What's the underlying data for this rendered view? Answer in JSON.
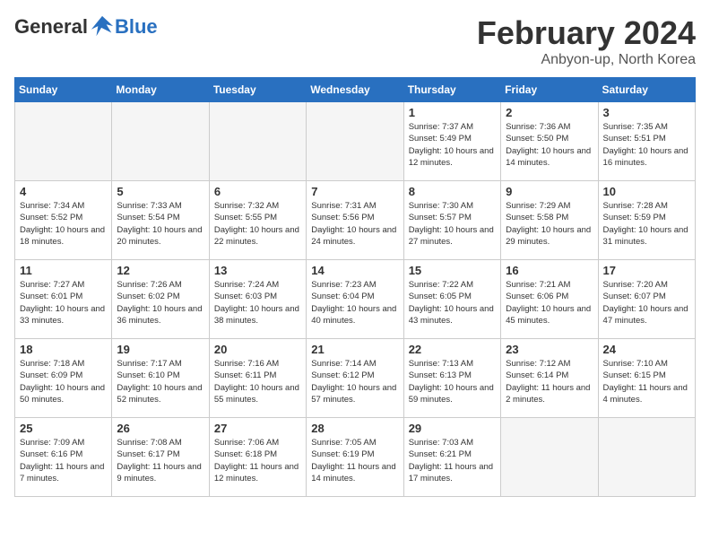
{
  "header": {
    "logo_general": "General",
    "logo_blue": "Blue",
    "month_year": "February 2024",
    "location": "Anbyon-up, North Korea"
  },
  "days_of_week": [
    "Sunday",
    "Monday",
    "Tuesday",
    "Wednesday",
    "Thursday",
    "Friday",
    "Saturday"
  ],
  "weeks": [
    [
      {
        "day": "",
        "sunrise": "",
        "sunset": "",
        "daylight": "",
        "empty": true
      },
      {
        "day": "",
        "sunrise": "",
        "sunset": "",
        "daylight": "",
        "empty": true
      },
      {
        "day": "",
        "sunrise": "",
        "sunset": "",
        "daylight": "",
        "empty": true
      },
      {
        "day": "",
        "sunrise": "",
        "sunset": "",
        "daylight": "",
        "empty": true
      },
      {
        "day": "1",
        "sunrise": "Sunrise: 7:37 AM",
        "sunset": "Sunset: 5:49 PM",
        "daylight": "Daylight: 10 hours and 12 minutes."
      },
      {
        "day": "2",
        "sunrise": "Sunrise: 7:36 AM",
        "sunset": "Sunset: 5:50 PM",
        "daylight": "Daylight: 10 hours and 14 minutes."
      },
      {
        "day": "3",
        "sunrise": "Sunrise: 7:35 AM",
        "sunset": "Sunset: 5:51 PM",
        "daylight": "Daylight: 10 hours and 16 minutes."
      }
    ],
    [
      {
        "day": "4",
        "sunrise": "Sunrise: 7:34 AM",
        "sunset": "Sunset: 5:52 PM",
        "daylight": "Daylight: 10 hours and 18 minutes."
      },
      {
        "day": "5",
        "sunrise": "Sunrise: 7:33 AM",
        "sunset": "Sunset: 5:54 PM",
        "daylight": "Daylight: 10 hours and 20 minutes."
      },
      {
        "day": "6",
        "sunrise": "Sunrise: 7:32 AM",
        "sunset": "Sunset: 5:55 PM",
        "daylight": "Daylight: 10 hours and 22 minutes."
      },
      {
        "day": "7",
        "sunrise": "Sunrise: 7:31 AM",
        "sunset": "Sunset: 5:56 PM",
        "daylight": "Daylight: 10 hours and 24 minutes."
      },
      {
        "day": "8",
        "sunrise": "Sunrise: 7:30 AM",
        "sunset": "Sunset: 5:57 PM",
        "daylight": "Daylight: 10 hours and 27 minutes."
      },
      {
        "day": "9",
        "sunrise": "Sunrise: 7:29 AM",
        "sunset": "Sunset: 5:58 PM",
        "daylight": "Daylight: 10 hours and 29 minutes."
      },
      {
        "day": "10",
        "sunrise": "Sunrise: 7:28 AM",
        "sunset": "Sunset: 5:59 PM",
        "daylight": "Daylight: 10 hours and 31 minutes."
      }
    ],
    [
      {
        "day": "11",
        "sunrise": "Sunrise: 7:27 AM",
        "sunset": "Sunset: 6:01 PM",
        "daylight": "Daylight: 10 hours and 33 minutes."
      },
      {
        "day": "12",
        "sunrise": "Sunrise: 7:26 AM",
        "sunset": "Sunset: 6:02 PM",
        "daylight": "Daylight: 10 hours and 36 minutes."
      },
      {
        "day": "13",
        "sunrise": "Sunrise: 7:24 AM",
        "sunset": "Sunset: 6:03 PM",
        "daylight": "Daylight: 10 hours and 38 minutes."
      },
      {
        "day": "14",
        "sunrise": "Sunrise: 7:23 AM",
        "sunset": "Sunset: 6:04 PM",
        "daylight": "Daylight: 10 hours and 40 minutes."
      },
      {
        "day": "15",
        "sunrise": "Sunrise: 7:22 AM",
        "sunset": "Sunset: 6:05 PM",
        "daylight": "Daylight: 10 hours and 43 minutes."
      },
      {
        "day": "16",
        "sunrise": "Sunrise: 7:21 AM",
        "sunset": "Sunset: 6:06 PM",
        "daylight": "Daylight: 10 hours and 45 minutes."
      },
      {
        "day": "17",
        "sunrise": "Sunrise: 7:20 AM",
        "sunset": "Sunset: 6:07 PM",
        "daylight": "Daylight: 10 hours and 47 minutes."
      }
    ],
    [
      {
        "day": "18",
        "sunrise": "Sunrise: 7:18 AM",
        "sunset": "Sunset: 6:09 PM",
        "daylight": "Daylight: 10 hours and 50 minutes."
      },
      {
        "day": "19",
        "sunrise": "Sunrise: 7:17 AM",
        "sunset": "Sunset: 6:10 PM",
        "daylight": "Daylight: 10 hours and 52 minutes."
      },
      {
        "day": "20",
        "sunrise": "Sunrise: 7:16 AM",
        "sunset": "Sunset: 6:11 PM",
        "daylight": "Daylight: 10 hours and 55 minutes."
      },
      {
        "day": "21",
        "sunrise": "Sunrise: 7:14 AM",
        "sunset": "Sunset: 6:12 PM",
        "daylight": "Daylight: 10 hours and 57 minutes."
      },
      {
        "day": "22",
        "sunrise": "Sunrise: 7:13 AM",
        "sunset": "Sunset: 6:13 PM",
        "daylight": "Daylight: 10 hours and 59 minutes."
      },
      {
        "day": "23",
        "sunrise": "Sunrise: 7:12 AM",
        "sunset": "Sunset: 6:14 PM",
        "daylight": "Daylight: 11 hours and 2 minutes."
      },
      {
        "day": "24",
        "sunrise": "Sunrise: 7:10 AM",
        "sunset": "Sunset: 6:15 PM",
        "daylight": "Daylight: 11 hours and 4 minutes."
      }
    ],
    [
      {
        "day": "25",
        "sunrise": "Sunrise: 7:09 AM",
        "sunset": "Sunset: 6:16 PM",
        "daylight": "Daylight: 11 hours and 7 minutes."
      },
      {
        "day": "26",
        "sunrise": "Sunrise: 7:08 AM",
        "sunset": "Sunset: 6:17 PM",
        "daylight": "Daylight: 11 hours and 9 minutes."
      },
      {
        "day": "27",
        "sunrise": "Sunrise: 7:06 AM",
        "sunset": "Sunset: 6:18 PM",
        "daylight": "Daylight: 11 hours and 12 minutes."
      },
      {
        "day": "28",
        "sunrise": "Sunrise: 7:05 AM",
        "sunset": "Sunset: 6:19 PM",
        "daylight": "Daylight: 11 hours and 14 minutes."
      },
      {
        "day": "29",
        "sunrise": "Sunrise: 7:03 AM",
        "sunset": "Sunset: 6:21 PM",
        "daylight": "Daylight: 11 hours and 17 minutes."
      },
      {
        "day": "",
        "sunrise": "",
        "sunset": "",
        "daylight": "",
        "empty": true
      },
      {
        "day": "",
        "sunrise": "",
        "sunset": "",
        "daylight": "",
        "empty": true
      }
    ]
  ]
}
